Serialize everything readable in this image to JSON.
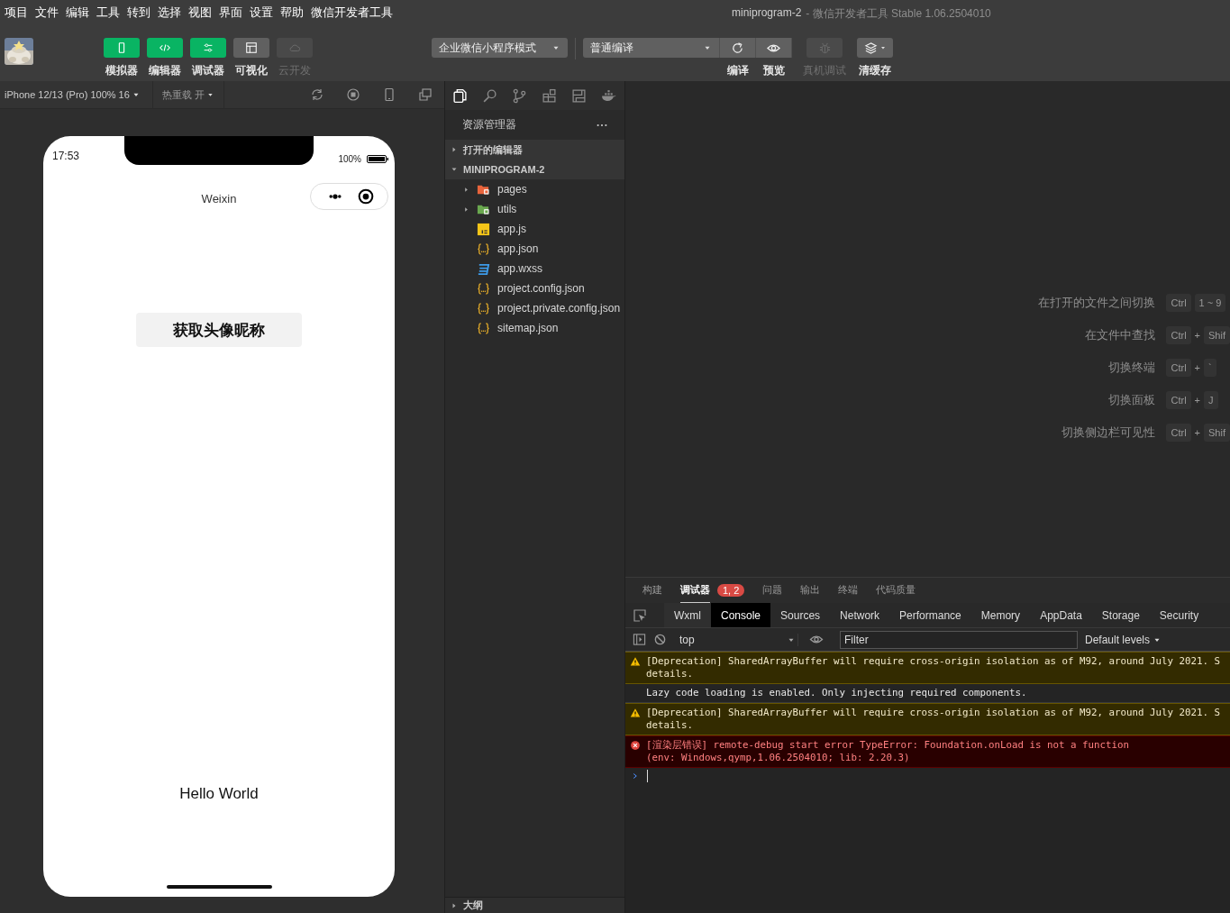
{
  "menu": [
    "项目",
    "文件",
    "编辑",
    "工具",
    "转到",
    "选择",
    "视图",
    "界面",
    "设置",
    "帮助",
    "微信开发者工具"
  ],
  "title": {
    "project": "miniprogram-2",
    "suffix": "- 微信开发者工具 Stable 1.06.2504010"
  },
  "toolbar": {
    "views": [
      {
        "label": "模拟器",
        "kind": "phone",
        "on": true,
        "disabled": false
      },
      {
        "label": "编辑器",
        "kind": "code",
        "on": true,
        "disabled": false
      },
      {
        "label": "调试器",
        "kind": "sliders",
        "on": true,
        "disabled": false
      },
      {
        "label": "可视化",
        "kind": "layout",
        "on": false,
        "disabled": false
      },
      {
        "label": "云开发",
        "kind": "cloud",
        "on": false,
        "disabled": true
      }
    ],
    "mode": "企业微信小程序模式",
    "compile_mode": "普通编译",
    "actions": [
      {
        "label": "编译",
        "kind": "refresh",
        "attached": true,
        "disabled": false
      },
      {
        "label": "预览",
        "kind": "eye",
        "attached": true,
        "disabled": false
      },
      {
        "label": "真机调试",
        "kind": "bug",
        "attached": false,
        "disabled": true
      },
      {
        "label": "清缓存",
        "kind": "layers",
        "attached": false,
        "disabled": false
      }
    ]
  },
  "simulator": {
    "device": "iPhone 12/13 (Pro) 100% 16",
    "hot_reload": "热重载 开",
    "phone": {
      "time": "17:53",
      "battery": "100%",
      "nav_title": "Weixin",
      "button": "获取头像昵称",
      "text": "Hello World"
    }
  },
  "explorer": {
    "title": "资源管理器",
    "sections": [
      {
        "label": "打开的编辑器",
        "expanded": false
      },
      {
        "label": "MINIPROGRAM-2",
        "expanded": true,
        "children": [
          {
            "name": "pages",
            "kind": "folder",
            "expanded": false,
            "color": "#e8643c"
          },
          {
            "name": "utils",
            "kind": "folder",
            "expanded": false,
            "color": "#6aa84f"
          },
          {
            "name": "app.js",
            "kind": "js"
          },
          {
            "name": "app.json",
            "kind": "json"
          },
          {
            "name": "app.wxss",
            "kind": "wxss"
          },
          {
            "name": "project.config.json",
            "kind": "json"
          },
          {
            "name": "project.private.config.json",
            "kind": "json"
          },
          {
            "name": "sitemap.json",
            "kind": "json"
          }
        ]
      }
    ],
    "outline": {
      "label": "大纲",
      "expanded": false
    }
  },
  "shortcuts": [
    {
      "label": "在打开的文件之间切换",
      "keys": [
        {
          "kind": "key",
          "text": "Ctrl"
        },
        {
          "kind": "key",
          "text": "1 ~ 9"
        }
      ]
    },
    {
      "label": "在文件中查找",
      "keys": [
        {
          "kind": "key",
          "text": "Ctrl"
        },
        {
          "kind": "plus",
          "text": "+"
        },
        {
          "kind": "key",
          "text": "Shif"
        }
      ]
    },
    {
      "label": "切换终端",
      "keys": [
        {
          "kind": "key",
          "text": "Ctrl"
        },
        {
          "kind": "plus",
          "text": "+"
        },
        {
          "kind": "key",
          "text": "`"
        }
      ]
    },
    {
      "label": "切换面板",
      "keys": [
        {
          "kind": "key",
          "text": "Ctrl"
        },
        {
          "kind": "plus",
          "text": "+"
        },
        {
          "kind": "key",
          "text": "J"
        }
      ]
    },
    {
      "label": "切换侧边栏可见性",
      "keys": [
        {
          "kind": "key",
          "text": "Ctrl"
        },
        {
          "kind": "plus",
          "text": "+"
        },
        {
          "kind": "key",
          "text": "Shif"
        }
      ]
    }
  ],
  "panel": {
    "tabs": [
      {
        "label": "构建",
        "selected": false
      },
      {
        "label": "调试器",
        "selected": true,
        "badge": "1, 2"
      },
      {
        "label": "问题",
        "selected": false
      },
      {
        "label": "输出",
        "selected": false
      },
      {
        "label": "终端",
        "selected": false
      },
      {
        "label": "代码质量",
        "selected": false
      }
    ]
  },
  "devtools": {
    "tabs": [
      {
        "label": "Wxml",
        "selected": false
      },
      {
        "label": "Console",
        "selected": true
      },
      {
        "label": "Sources",
        "selected": false
      },
      {
        "label": "Network",
        "selected": false
      },
      {
        "label": "Performance",
        "selected": false
      },
      {
        "label": "Memory",
        "selected": false
      },
      {
        "label": "AppData",
        "selected": false
      },
      {
        "label": "Storage",
        "selected": false
      },
      {
        "label": "Security",
        "selected": false
      }
    ],
    "context": "top",
    "filter": {
      "placeholder": "Filter"
    },
    "levels": "Default levels",
    "messages": [
      {
        "kind": "warning",
        "lines": [
          "[Deprecation] SharedArrayBuffer will require cross-origin isolation as of M92, around July 2021. S",
          "details."
        ]
      },
      {
        "kind": "info",
        "lines": [
          "Lazy code loading is enabled. Only injecting required components."
        ]
      },
      {
        "kind": "warning",
        "lines": [
          "[Deprecation] SharedArrayBuffer will require cross-origin isolation as of M92, around July 2021. S",
          "details."
        ]
      },
      {
        "kind": "error",
        "lines": [
          "[渲染层错误] remote-debug start error TypeError: Foundation.onLoad is not a function",
          "(env: Windows,qymp,1.06.2504010; lib: 2.20.3)"
        ]
      }
    ]
  }
}
